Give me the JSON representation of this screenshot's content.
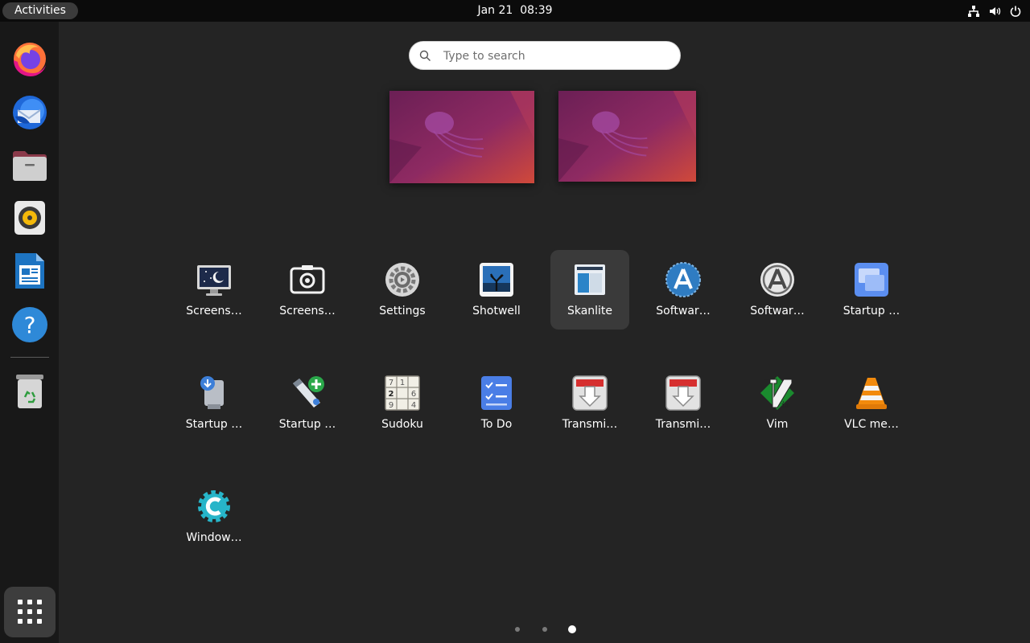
{
  "topbar": {
    "activities_label": "Activities",
    "date": "Jan 21",
    "time": "08:39",
    "tray_icons": [
      "network-icon",
      "volume-icon",
      "power-icon"
    ]
  },
  "dock": {
    "items": [
      {
        "name": "Firefox",
        "icon": "firefox-icon"
      },
      {
        "name": "Thunderbird Mail",
        "icon": "thunderbird-icon"
      },
      {
        "name": "Files",
        "icon": "files-icon"
      },
      {
        "name": "Rhythmbox",
        "icon": "rhythmbox-icon"
      },
      {
        "name": "LibreOffice Writer",
        "icon": "writer-icon"
      },
      {
        "name": "Help",
        "icon": "help-icon"
      },
      {
        "name": "Trash",
        "icon": "trash-icon"
      }
    ],
    "show_apps_icon": "grid-icon"
  },
  "search": {
    "placeholder": "Type to search",
    "value": ""
  },
  "workspaces": [
    {
      "name": "workspace-1"
    },
    {
      "name": "workspace-2"
    }
  ],
  "apps": [
    {
      "label": "Screens…",
      "icon": "screensaver-icon"
    },
    {
      "label": "Screens…",
      "icon": "screenshot-icon"
    },
    {
      "label": "Settings",
      "icon": "settings-icon"
    },
    {
      "label": "Shotwell",
      "icon": "shotwell-icon"
    },
    {
      "label": "Skanlite",
      "icon": "skanlite-icon",
      "selected": true
    },
    {
      "label": "Softwar…",
      "icon": "software-icon"
    },
    {
      "label": "Softwar…",
      "icon": "software-updater-icon"
    },
    {
      "label": "Startup …",
      "icon": "startup-applications-icon"
    },
    {
      "label": "Startup …",
      "icon": "startup-disk-icon"
    },
    {
      "label": "Startup …",
      "icon": "usb-creator-icon"
    },
    {
      "label": "Sudoku",
      "icon": "sudoku-icon"
    },
    {
      "label": "To Do",
      "icon": "todo-icon"
    },
    {
      "label": "Transmi…",
      "icon": "transmission-icon"
    },
    {
      "label": "Transmi…",
      "icon": "transmission-icon"
    },
    {
      "label": "Vim",
      "icon": "vim-icon"
    },
    {
      "label": "VLC me…",
      "icon": "vlc-icon"
    },
    {
      "label": "Window…",
      "icon": "window-manager-icon"
    }
  ],
  "sudoku_digits": [
    "7",
    "1",
    "2",
    "6",
    "9",
    "4"
  ],
  "pager": {
    "pages": 3,
    "current": 3
  },
  "colors": {
    "background": "#242424",
    "topbar": "#0b0b0b",
    "dock": "#181818",
    "accent": "#e95420"
  }
}
